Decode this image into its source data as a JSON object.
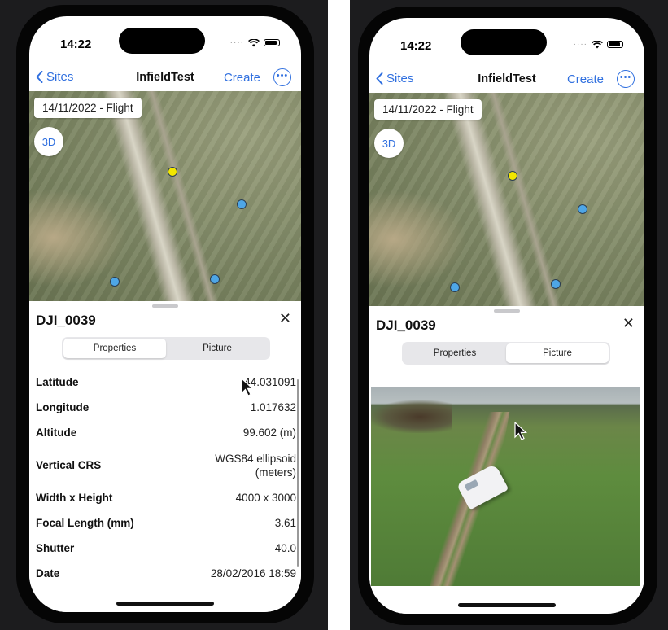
{
  "colors": {
    "accent": "#2f6fdf",
    "marker_blue": "#4ea6e6",
    "marker_yellow": "#f2e600"
  },
  "left": {
    "status": {
      "time": "14:22"
    },
    "nav": {
      "back_label": "Sites",
      "title": "InfieldTest",
      "create_label": "Create"
    },
    "map": {
      "date_label": "14/11/2022 - Flight",
      "three_d_label": "3D"
    },
    "sheet": {
      "title": "DJI_0039",
      "tabs": [
        {
          "label": "Properties",
          "selected": true
        },
        {
          "label": "Picture",
          "selected": false
        }
      ],
      "properties": [
        {
          "label": "Latitude",
          "value": "44.031091"
        },
        {
          "label": "Longitude",
          "value": "1.017632"
        },
        {
          "label": "Altitude",
          "value": "99.602 (m)"
        },
        {
          "label": "Vertical CRS",
          "value_line1": "WGS84 ellipsoid",
          "value_line2": "(meters)"
        },
        {
          "label": "Width x Height",
          "value": "4000 x 3000"
        },
        {
          "label": "Focal Length (mm)",
          "value": "3.61"
        },
        {
          "label": "Shutter",
          "value": "40.0"
        },
        {
          "label": "Date",
          "value": "28/02/2016 18:59"
        }
      ]
    }
  },
  "right": {
    "status": {
      "time": "14:22"
    },
    "nav": {
      "back_label": "Sites",
      "title": "InfieldTest",
      "create_label": "Create"
    },
    "map": {
      "date_label": "14/11/2022 - Flight",
      "three_d_label": "3D"
    },
    "sheet": {
      "title": "DJI_0039",
      "tabs": [
        {
          "label": "Properties",
          "selected": false
        },
        {
          "label": "Picture",
          "selected": true
        }
      ]
    }
  }
}
